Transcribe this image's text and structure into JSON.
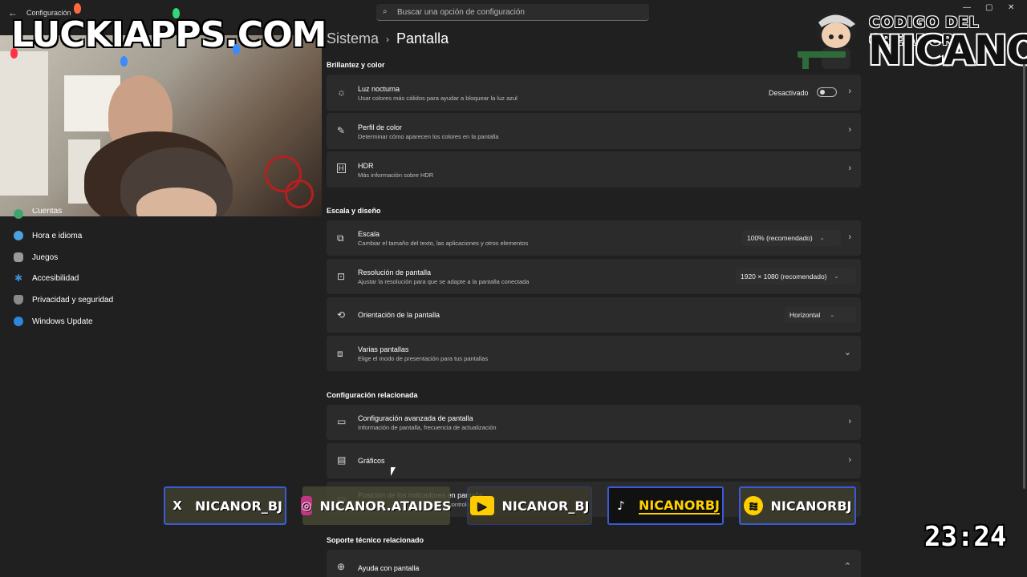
{
  "app": {
    "back_icon": "back-arrow-icon",
    "title": "Configuración"
  },
  "search": {
    "placeholder": "Buscar una opción de configuración"
  },
  "overlay": {
    "site_logo": "LUCKIAPPS.COM",
    "creator_label": "CODIGO DEL CREADOR",
    "creator_name": "NICANOR",
    "clock": "23:24"
  },
  "nav": {
    "items": [
      {
        "label": "Cuentas",
        "icon": "account-icon",
        "color": "#3fa66b"
      },
      {
        "label": "Hora e idioma",
        "icon": "globe-clock-icon",
        "color": "#4aa3df"
      },
      {
        "label": "Juegos",
        "icon": "gamepad-icon",
        "color": "#9a9a9a"
      },
      {
        "label": "Accesibilidad",
        "icon": "accessibility-icon",
        "color": "#3b8fd9"
      },
      {
        "label": "Privacidad y seguridad",
        "icon": "shield-icon",
        "color": "#8a8a8a"
      },
      {
        "label": "Windows Update",
        "icon": "update-icon",
        "color": "#2e86de"
      }
    ]
  },
  "breadcrumb": {
    "parent": "Sistema",
    "current": "Pantalla"
  },
  "sections": {
    "brightness": "Brillantez y color",
    "scale": "Escala y diseño",
    "related": "Configuración relacionada",
    "support": "Soporte técnico relacionado"
  },
  "cards": {
    "night_light": {
      "title": "Luz nocturna",
      "subtitle": "Usar colores más cálidos para ayudar a bloquear la luz azul",
      "state": "Desactivado"
    },
    "color_profile": {
      "title": "Perfil de color",
      "subtitle": "Determinar cómo aparecen los colores en la pantalla"
    },
    "hdr": {
      "title": "HDR",
      "subtitle": "Más información sobre HDR"
    },
    "scale": {
      "title": "Escala",
      "subtitle": "Cambiar el tamaño del texto, las aplicaciones y otros elementos",
      "value": "100% (recomendado)"
    },
    "resolution": {
      "title": "Resolución de pantalla",
      "subtitle": "Ajustar la resolución para que se adapte a la pantalla conectada",
      "value": "1920 × 1080 (recomendado)"
    },
    "orientation": {
      "title": "Orientación de la pantalla",
      "value": "Horizontal"
    },
    "multi": {
      "title": "Varias pantallas",
      "subtitle": "Elige el modo de presentación para tus pantallas"
    },
    "advanced": {
      "title": "Configuración avanzada de pantalla",
      "subtitle": "Información de pantalla, frecuencia de actualización"
    },
    "graphics": {
      "title": "Gráficos"
    },
    "indicators": {
      "title": "Posición de los indicadores en pantalla",
      "subtitle": "controles apar"
    },
    "help": {
      "title": "Ayuda con pantalla"
    }
  },
  "socials": [
    {
      "handle": "NICANOR_BJ",
      "icon": "x-icon",
      "glyph": "X",
      "color": "#1a1a1a"
    },
    {
      "handle": "NICANOR.ATAIDES",
      "icon": "instagram-icon",
      "glyph": "◎",
      "color": "#c13584"
    },
    {
      "handle": "NICANOR_BJ",
      "icon": "youtube-icon",
      "glyph": "▶",
      "color": "#ff2a2a"
    },
    {
      "handle": "NICANORBJ",
      "icon": "tiktok-icon",
      "glyph": "♪",
      "color": "#111111"
    },
    {
      "handle": "NICANORBJ",
      "icon": "spotify-icon",
      "glyph": "≋",
      "color": "#1db954"
    }
  ],
  "colors": {
    "background": "#202020",
    "card": "#2b2b2b",
    "social_border": "#3b5bd6"
  }
}
